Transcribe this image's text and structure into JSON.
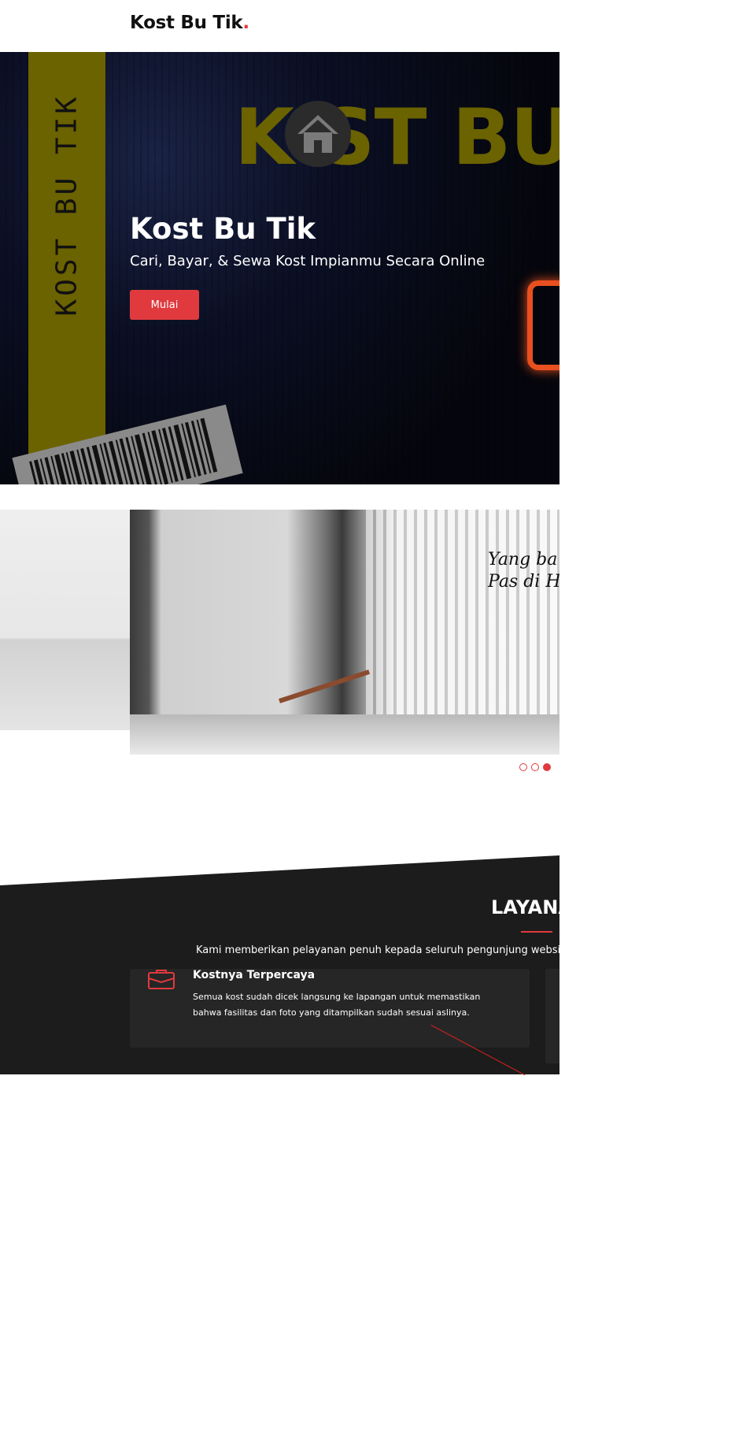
{
  "header": {
    "brand": "Kost Bu Tik",
    "brand_dot": "."
  },
  "hero": {
    "stripe_text": "KOST BU TIK",
    "big_brand": "K  ST BU",
    "title": "Kost Bu Tik",
    "subtitle": "Cari, Bayar, & Sewa Kost Impianmu Secara Online",
    "button": "Mulai"
  },
  "slider": {
    "quote_line1": "Yang ba",
    "quote_line2": "Pas di H",
    "active_index": 2,
    "count": 3
  },
  "services": {
    "title": "LAYANA",
    "description": "Kami memberikan pelayanan penuh kepada seluruh pengunjung website untu",
    "cards": [
      {
        "icon": "briefcase-icon",
        "title": "Kostnya Terpercaya",
        "text": "Semua kost sudah dicek langsung ke lapangan untuk memastikan bahwa fasilitas dan foto yang ditampilkan sudah sesuai aslinya."
      }
    ]
  },
  "colors": {
    "accent": "#e03a3e",
    "dark": "#1c1c1c",
    "olive": "#6b6200"
  }
}
